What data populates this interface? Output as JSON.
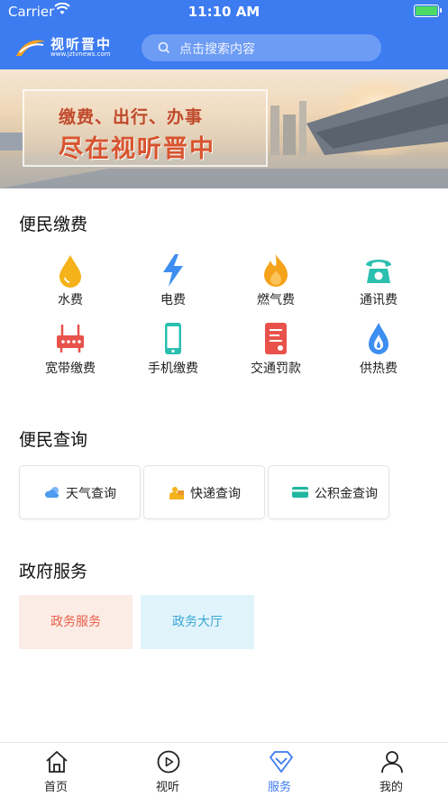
{
  "status_bar": {
    "carrier": "Carrier",
    "time": "11:10 AM"
  },
  "header": {
    "brand": "视听晋中",
    "url": "www.jztvnews.com",
    "search_placeholder": "点击搜索内容",
    "bg_color": "#3d7bf0"
  },
  "banner": {
    "line1": "缴费、出行、办事",
    "line2": "尽在视听晋中"
  },
  "payment": {
    "title": "便民缴费",
    "items": [
      {
        "label": "水费",
        "icon": "water-drop-icon",
        "color": "#f5b21a"
      },
      {
        "label": "电费",
        "icon": "lightning-icon",
        "color": "#3d8ef0"
      },
      {
        "label": "燃气费",
        "icon": "flame-icon",
        "color": "#f5a31a"
      },
      {
        "label": "通讯费",
        "icon": "telephone-icon",
        "color": "#2bbfb0"
      },
      {
        "label": "宽带缴费",
        "icon": "router-icon",
        "color": "#e8524a"
      },
      {
        "label": "手机缴费",
        "icon": "mobile-phone-icon",
        "color": "#2bbfb0"
      },
      {
        "label": "交通罚款",
        "icon": "ticket-icon",
        "color": "#e8524a"
      },
      {
        "label": "供热费",
        "icon": "heating-drop-icon",
        "color": "#3d8ef0"
      }
    ]
  },
  "query": {
    "title": "便民查询",
    "items": [
      {
        "label": "天气查询",
        "icon": "weather-icon"
      },
      {
        "label": "快递查询",
        "icon": "delivery-icon"
      },
      {
        "label": "公积金查询",
        "icon": "card-icon"
      }
    ]
  },
  "gov": {
    "title": "政府服务",
    "items": [
      {
        "label": "政务服务",
        "bg": "#fcece6",
        "color": "#e8604a"
      },
      {
        "label": "政务大厅",
        "bg": "#e2f4fb",
        "color": "#3aa6d8"
      }
    ]
  },
  "tabbar": {
    "tabs": [
      {
        "label": "首页",
        "icon": "home-icon"
      },
      {
        "label": "视听",
        "icon": "play-icon"
      },
      {
        "label": "服务",
        "icon": "diamond-icon",
        "active": true
      },
      {
        "label": "我的",
        "icon": "user-icon"
      }
    ]
  }
}
